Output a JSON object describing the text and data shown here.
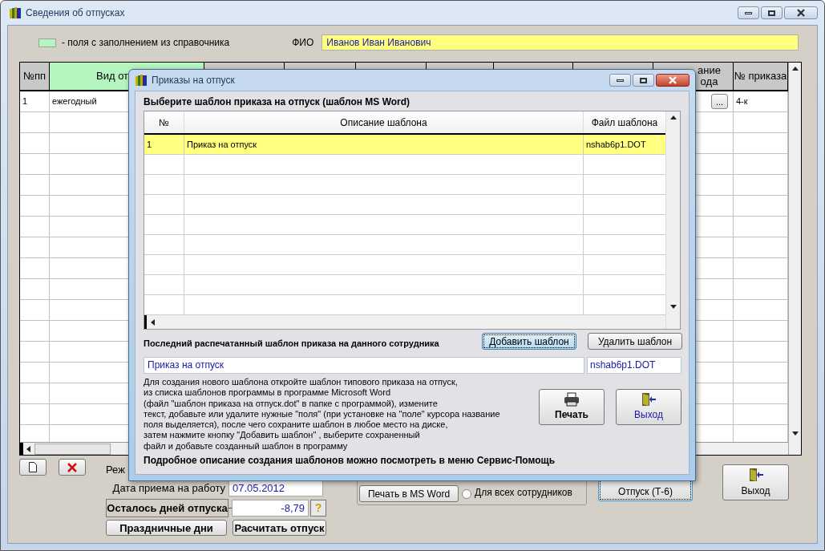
{
  "window": {
    "title": "Сведения об отпусках"
  },
  "legend": {
    "text": "- поля с заполнением из справочника"
  },
  "fio": {
    "label": "ФИО",
    "value": "Иванов Иван Иванович"
  },
  "table": {
    "columns": [
      {
        "label": "№пп",
        "dictionary": false
      },
      {
        "label": "Вид от",
        "dictionary": true
      },
      {
        "dictionary": false
      },
      {
        "dictionary": false
      },
      {
        "dictionary": false
      },
      {
        "dictionary": false
      },
      {
        "dictionary": false
      },
      {
        "dictionary": false
      },
      {
        "label_lines": [
          "ание",
          "ода"
        ],
        "dictionary": false
      },
      {
        "label": "№ приказа",
        "dictionary": false
      }
    ],
    "rows": [
      {
        "number": "1",
        "kind_of_leave": "ежегодный",
        "lookup_button": "...",
        "order_no": "4-к"
      }
    ]
  },
  "mode_label": "Реж",
  "hire_date": {
    "label": "Дата приема на работу",
    "value": "07.05.2012"
  },
  "remaining": {
    "label": "Осталось дней отпуска",
    "value": "-8,79",
    "help": "?"
  },
  "holidays_button": "Праздничные дни",
  "calc_button": "Расчитать отпуск",
  "print_word_button": "Печать в MS Word",
  "all_employees": {
    "label": "Для всех сотрудников",
    "checked": false
  },
  "leave_button": {
    "label": "Отпуск (Т-6)",
    "focused": true
  },
  "exit_button": {
    "label": "Выход",
    "focused": false
  },
  "dialog": {
    "title": "Приказы на отпуск",
    "heading": "Выберите шаблон приказа на отпуск (шаблон MS Word)",
    "columns": [
      "№",
      "Описание шаблона",
      "Файл шаблона"
    ],
    "rows": [
      {
        "no": "1",
        "description": "Приказ на отпуск",
        "file": "nshab6p1.DOT",
        "selected": true
      }
    ],
    "last_label": "Последний распечатанный шаблон приказа на  данного сотрудника",
    "buttons": [
      {
        "label": "Добавить шаблон",
        "focused": true
      },
      {
        "label": "Удалить шаблон",
        "focused": false
      }
    ],
    "last_name": "Приказ на отпуск",
    "last_file": "nshab6p1.DOT",
    "help_lines": [
      "Для создания нового шаблона откройте шаблон типового приказа на отпуск,",
      "из списка шаблонов программы в программе Microsoft Word",
      "(файл \"шаблон приказа на отпуск.dot\" в папке  с программой),  измените",
      "текст, добавьте или удалите нужные \"поля\" (при установке на \"поле\" курсора название",
      "поля выделяется), после чего сохраните шаблон в любое место на диске,",
      "затем нажмите кнопку \"Добавить шаблон\" , выберите сохраненный",
      "файл и добавьте созданный шаблон в программу"
    ],
    "footer": "Подробное описание создания шаблонов можно посмотреть в меню Сервис-Помощь",
    "print_button": "Печать",
    "exit_button": "Выход"
  }
}
